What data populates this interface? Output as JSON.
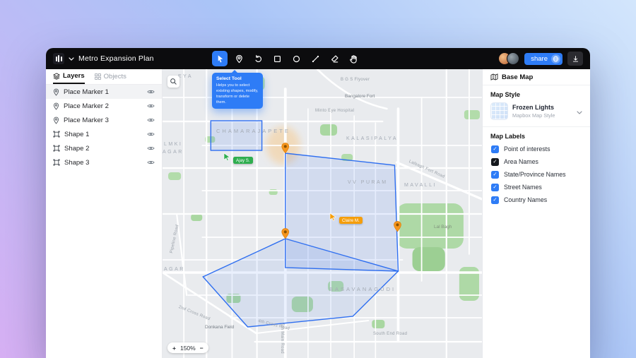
{
  "header": {
    "title": "Metro Expansion Plan",
    "tools": [
      {
        "name": "select-tool",
        "active": true
      },
      {
        "name": "marker-tool",
        "active": false
      },
      {
        "name": "redo-tool",
        "active": false
      },
      {
        "name": "rectangle-tool",
        "active": false
      },
      {
        "name": "circle-tool",
        "active": false
      },
      {
        "name": "line-tool",
        "active": false
      },
      {
        "name": "eraser-tool",
        "active": false
      },
      {
        "name": "hand-tool",
        "active": false
      }
    ],
    "share_label": "share",
    "accent_color": "#2e7cf6"
  },
  "sidebar": {
    "tabs": [
      {
        "label": "Layers",
        "active": true
      },
      {
        "label": "Objects",
        "active": false
      }
    ],
    "items": [
      {
        "label": "Place Marker 1",
        "type": "marker",
        "selected": true
      },
      {
        "label": "Place Marker 2",
        "type": "marker",
        "selected": false
      },
      {
        "label": "Place Marker 3",
        "type": "marker",
        "selected": false
      },
      {
        "label": "Shape 1",
        "type": "shape",
        "selected": false
      },
      {
        "label": "Shape 2",
        "type": "shape",
        "selected": false
      },
      {
        "label": "Shape 3",
        "type": "shape",
        "selected": false
      }
    ]
  },
  "map": {
    "tooltip": {
      "title": "Select Tool",
      "body": "Helps you to select existing shapes, modify, transform or delete them."
    },
    "zoom_in": "+",
    "zoom_level": "150%",
    "zoom_out": "−",
    "cursors": [
      {
        "name": "Ajay S.",
        "color": "#2fae4f"
      },
      {
        "name": "Claire M.",
        "color": "#f59e0b"
      }
    ],
    "marker_color": "#f6951d",
    "shape_color": "#2f6ff0",
    "labels": [
      {
        "text": "EYA"
      },
      {
        "text": "B G S Flyover"
      },
      {
        "text": "Bangalore Fort"
      },
      {
        "text": "Minto Eye Hospital"
      },
      {
        "text": "CHAMARAJAPETE"
      },
      {
        "text": "KALASIPALYA"
      },
      {
        "text": "LMKI"
      },
      {
        "text": "AGAR"
      },
      {
        "text": "VV PURAM"
      },
      {
        "text": "MAVALLI"
      },
      {
        "text": "Lalbagh Fort Road"
      },
      {
        "text": "Lal Bagh"
      },
      {
        "text": "Pipeline Road"
      },
      {
        "text": "AGAR"
      },
      {
        "text": "BASAVANAGUDI"
      },
      {
        "text": "2nd Cross Road"
      },
      {
        "text": "Donkana Field"
      },
      {
        "text": "4th Cross Road"
      },
      {
        "text": "South End Road"
      },
      {
        "text": "5th Main Road"
      }
    ]
  },
  "basemap_panel": {
    "title": "Base Map",
    "style_heading": "Map Style",
    "style_name": "Frozen Lights",
    "style_subtitle": "Mapbox Map Style",
    "labels_heading": "Map Labels",
    "checkboxes": [
      {
        "label": "Point of interests",
        "checked": true,
        "color": "#2e7cf6"
      },
      {
        "label": "Area Names",
        "checked": true,
        "color": "#15181d"
      },
      {
        "label": "State/Province Names",
        "checked": true,
        "color": "#2e7cf6"
      },
      {
        "label": "Street Names",
        "checked": true,
        "color": "#2e7cf6"
      },
      {
        "label": "Country Names",
        "checked": true,
        "color": "#2e7cf6"
      }
    ]
  }
}
